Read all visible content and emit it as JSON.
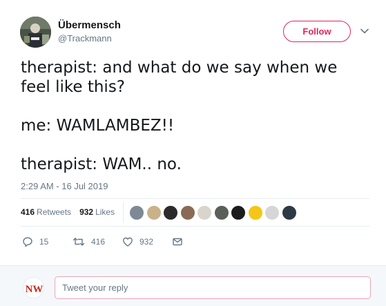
{
  "author": {
    "display_name": "Übermensch",
    "handle": "@Trackmann",
    "avatar_icon": "user-avatar-photo"
  },
  "follow_button": {
    "label": "Follow",
    "color": "#e0245e"
  },
  "more_menu": {
    "icon": "chevron-down-icon"
  },
  "tweet": {
    "lines": [
      "therapist: and what do we say when we feel like this?",
      "me: WAMLAMBEZ!!",
      "therapist: WAM.. no."
    ],
    "timestamp": "2:29 AM - 16 Jul 2019"
  },
  "stats": {
    "retweets_count": "416",
    "retweets_label": "Retweets",
    "likes_count": "932",
    "likes_label": "Likes",
    "likers": [
      {
        "color": "#7d8a96"
      },
      {
        "color": "#c9b28a"
      },
      {
        "color": "#2b2b2b"
      },
      {
        "color": "#8a6a55"
      },
      {
        "color": "#d9d4cc"
      },
      {
        "color": "#5b5f5a"
      },
      {
        "color": "#1c1c1c"
      },
      {
        "color": "#f5c518"
      },
      {
        "color": "#d6d6d6"
      },
      {
        "color": "#2d3a45"
      }
    ]
  },
  "actions": {
    "reply_count": "15",
    "retweet_count": "416",
    "like_count": "932",
    "reply_icon": "reply-icon",
    "retweet_icon": "retweet-icon",
    "like_icon": "heart-icon",
    "dm_icon": "envelope-icon"
  },
  "reply": {
    "placeholder": "Tweet your reply",
    "avatar_text": "NW",
    "avatar_color": "#d0251f"
  }
}
